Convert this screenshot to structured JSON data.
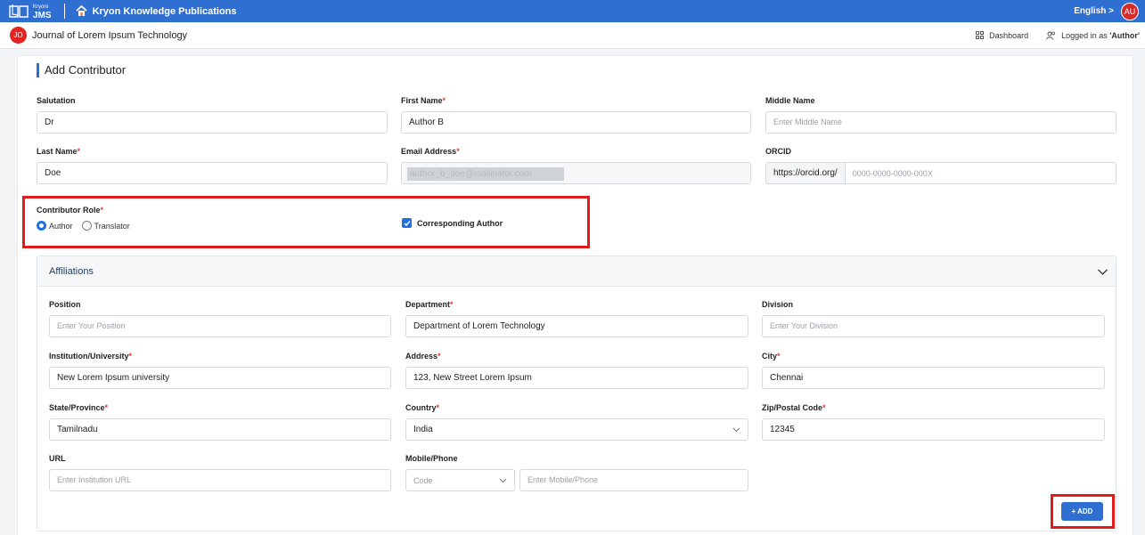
{
  "topbar": {
    "logo_small": "Kryoni",
    "logo_big": "JMS",
    "publication_title": "Kryon Knowledge Publications",
    "language": "English",
    "language_chevron": ">",
    "user_initials": "AU",
    "colors": {
      "bar": "#2f6fd1",
      "avatar": "#d42a2a"
    }
  },
  "subbar": {
    "journal_initials": "JO",
    "journal_title": "Journal of Lorem Ipsum Technology",
    "dashboard_label": "Dashboard",
    "logged_in_prefix": "Logged in as ",
    "logged_in_role": "'Author'"
  },
  "form": {
    "title": "Add Contributor",
    "salutation": {
      "label": "Salutation",
      "value": "Dr"
    },
    "first_name": {
      "label": "First Name",
      "required": "*",
      "value": "Author B"
    },
    "middle_name": {
      "label": "Middle Name",
      "placeholder": "Enter Middle Name"
    },
    "last_name": {
      "label": "Last Name",
      "required": "*",
      "value": "Doe"
    },
    "email": {
      "label": "Email Address",
      "required": "*",
      "value": "author_b_doe@mailinator.com"
    },
    "orcid": {
      "label": "ORCID",
      "prefix": "https://orcid.org/",
      "placeholder": "0000-0000-0000-000X"
    },
    "contributor_role": {
      "label": "Contributor Role",
      "required": "*",
      "options": [
        "Author",
        "Translator"
      ],
      "selected": "Author"
    },
    "corresponding_author": {
      "label": "Corresponding Author",
      "checked": true
    }
  },
  "affiliations": {
    "title": "Affiliations",
    "position": {
      "label": "Position",
      "placeholder": "Enter Your Position"
    },
    "department": {
      "label": "Department",
      "required": "*",
      "value": "Department of Lorem Technology"
    },
    "division": {
      "label": "Division",
      "placeholder": "Enter Your Division"
    },
    "institution": {
      "label": "Institution/University",
      "required": "*",
      "value": "New Lorem Ipsum university"
    },
    "address": {
      "label": "Address",
      "required": "*",
      "value": "123, New Street Lorem Ipsum"
    },
    "city": {
      "label": "City",
      "required": "*",
      "value": "Chennai"
    },
    "state": {
      "label": "State/Province",
      "required": "*",
      "value": "Tamilnadu"
    },
    "country": {
      "label": "Country",
      "required": "*",
      "value": "India"
    },
    "zip": {
      "label": "Zip/Postal Code",
      "required": "*",
      "value": "12345"
    },
    "url": {
      "label": "URL",
      "placeholder": "Enter Institution URL"
    },
    "mobile": {
      "label": "Mobile/Phone",
      "code_placeholder": "Code",
      "placeholder": "Enter Mobile/Phone"
    },
    "add_button": "+ ADD"
  },
  "highlight_color": "#e21b1b"
}
